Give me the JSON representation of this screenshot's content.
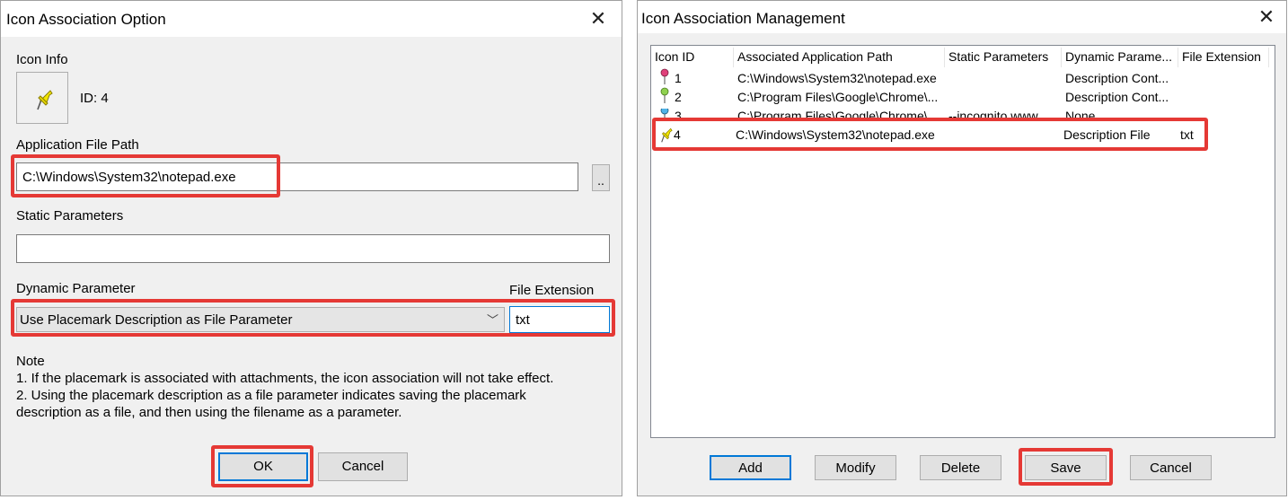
{
  "left_dialog": {
    "title": "Icon Association Option",
    "icon_info_label": "Icon Info",
    "id_text": "ID: 4",
    "app_path_label": "Application File Path",
    "app_path_value": "C:\\Windows\\System32\\notepad.exe",
    "browse_label": "..",
    "static_params_label": "Static Parameters",
    "static_params_value": "",
    "dynamic_param_label": "Dynamic Parameter",
    "dynamic_param_value": "Use Placemark Description as File Parameter",
    "file_ext_label": "File Extension",
    "file_ext_value": "txt",
    "note_title": "Note",
    "note_line1": "1. If the placemark is associated with attachments, the icon association will not take effect.",
    "note_line2": "2. Using the placemark description as a file parameter indicates saving the placemark",
    "note_line3": "description as a file, and then using the filename as a parameter.",
    "ok_label": "OK",
    "cancel_label": "Cancel"
  },
  "right_dialog": {
    "title": "Icon Association Management",
    "columns": [
      "Icon ID",
      "Associated Application Path",
      "Static Parameters",
      "Dynamic Parame...",
      "File Extension"
    ],
    "rows": [
      {
        "id": "1",
        "path": "C:\\Windows\\System32\\notepad.exe",
        "static": "",
        "dynamic": "Description Cont...",
        "ext": "",
        "pin_color": "#e0407a"
      },
      {
        "id": "2",
        "path": "C:\\Program Files\\Google\\Chrome\\...",
        "static": "",
        "dynamic": "Description Cont...",
        "ext": "",
        "pin_color": "#8fd14f"
      },
      {
        "id": "3",
        "path": "C:\\Program Files\\Google\\Chrome\\...",
        "static": "--incognito www....",
        "dynamic": "None",
        "ext": "",
        "pin_color": "#4fb3e8"
      },
      {
        "id": "4",
        "path": "C:\\Windows\\System32\\notepad.exe",
        "static": "",
        "dynamic": "Description File",
        "ext": "txt",
        "pin_color": "#f2e600"
      }
    ],
    "buttons": {
      "add": "Add",
      "modify": "Modify",
      "delete": "Delete",
      "save": "Save",
      "cancel": "Cancel"
    }
  },
  "colors": {
    "highlight": "#e53935",
    "focus": "#0078d7"
  }
}
